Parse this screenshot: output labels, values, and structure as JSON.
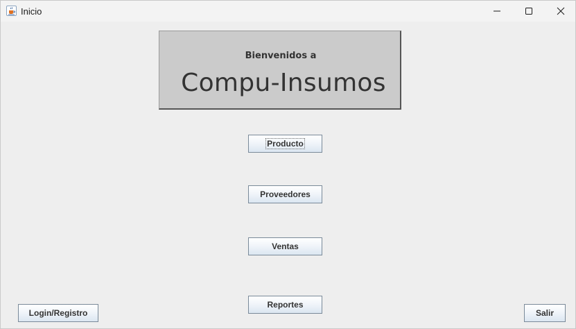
{
  "window": {
    "title": "Inicio",
    "app_icon": "java-cup-icon",
    "controls": [
      "minimize-icon",
      "maximize-icon",
      "close-icon"
    ]
  },
  "welcome": {
    "subtitle": "Bienvenidos a",
    "title": "Compu-Insumos"
  },
  "menu": {
    "producto": "Producto",
    "proveedores": "Proveedores",
    "ventas": "Ventas",
    "reportes": "Reportes"
  },
  "footer": {
    "login": "Login/Registro",
    "salir": "Salir"
  },
  "colors": {
    "background": "#eeeeee",
    "panel": "#cbcbcb",
    "text": "#333333",
    "button_border": "#7a8a99"
  },
  "focused_button": "Producto"
}
